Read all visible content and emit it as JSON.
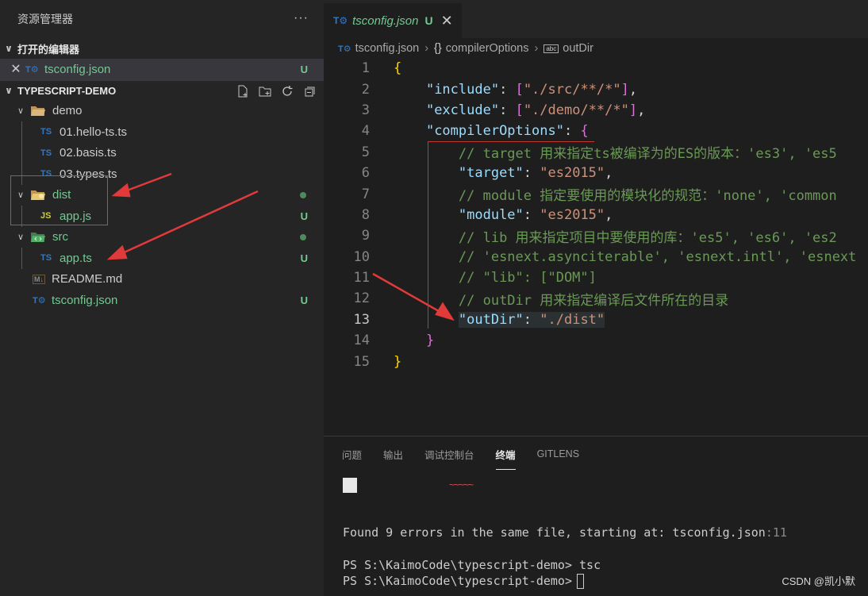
{
  "sidebar": {
    "title": "资源管理器",
    "more_label": "···",
    "open_editors": {
      "header": "打开的编辑器",
      "items": [
        {
          "name": "tsconfig.json",
          "badge": "U"
        }
      ]
    },
    "project": {
      "header": "TYPESCRIPT-DEMO",
      "tree": [
        {
          "name": "demo",
          "type": "folder"
        },
        {
          "name": "01.hello-ts.ts",
          "type": "ts"
        },
        {
          "name": "02.basis.ts",
          "type": "ts"
        },
        {
          "name": "03.types.ts",
          "type": "ts"
        },
        {
          "name": "dist",
          "type": "folder"
        },
        {
          "name": "app.js",
          "type": "js",
          "badge": "U"
        },
        {
          "name": "src",
          "type": "folder"
        },
        {
          "name": "app.ts",
          "type": "ts",
          "badge": "U"
        },
        {
          "name": "README.md",
          "type": "md"
        },
        {
          "name": "tsconfig.json",
          "type": "tsconfig",
          "badge": "U"
        }
      ]
    }
  },
  "editor": {
    "tab": {
      "name": "tsconfig.json",
      "status": "U"
    },
    "breadcrumb": [
      "tsconfig.json",
      "compilerOptions",
      "outDir"
    ],
    "lines": [
      {
        "n": "1"
      },
      {
        "n": "2"
      },
      {
        "n": "3"
      },
      {
        "n": "4"
      },
      {
        "n": "5"
      },
      {
        "n": "6"
      },
      {
        "n": "7"
      },
      {
        "n": "8"
      },
      {
        "n": "9"
      },
      {
        "n": "10"
      },
      {
        "n": "11"
      },
      {
        "n": "12"
      },
      {
        "n": "13"
      },
      {
        "n": "14"
      },
      {
        "n": "15"
      }
    ],
    "code": {
      "l2_key": "\"include\"",
      "l2_val": "\"./src/**/*\"",
      "l3_key": "\"exclude\"",
      "l3_val": "\"./demo/**/*\"",
      "l4_key": "\"compilerOptions\"",
      "l5": "// target 用来指定ts被编译为的ES的版本：'es3', 'es5",
      "l6_key": "\"target\"",
      "l6_val": "\"es2015\"",
      "l7": "// module 指定要使用的模块化的规范：'none', 'common",
      "l8_key": "\"module\"",
      "l8_val": "\"es2015\"",
      "l9": "// lib 用来指定项目中要使用的库：'es5', 'es6', 'es2",
      "l10": "// 'esnext.asynciterable', 'esnext.intl', 'esnext",
      "l11": "// \"lib\": [\"DOM\"]",
      "l12": "// outDir 用来指定编译后文件所在的目录",
      "l13_key": "\"outDir\"",
      "l13_val": "\"./dist\""
    }
  },
  "panel": {
    "tabs": [
      "问题",
      "输出",
      "调试控制台",
      "终端",
      "GITLENS"
    ],
    "active_tab": "终端",
    "squiggle": "~~~~~",
    "error_line_main": "Found 9 errors in the same file, starting at: tsconfig.json",
    "error_line_suffix": ":11",
    "prompt1": "PS S:\\KaimoCode\\typescript-demo> tsc",
    "prompt2": "PS S:\\KaimoCode\\typescript-demo>"
  },
  "watermark": "CSDN @凯小默",
  "colors": {
    "accent_green": "#73c991",
    "annotation_red": "#e03a3a",
    "ts_blue": "#3178c6"
  }
}
